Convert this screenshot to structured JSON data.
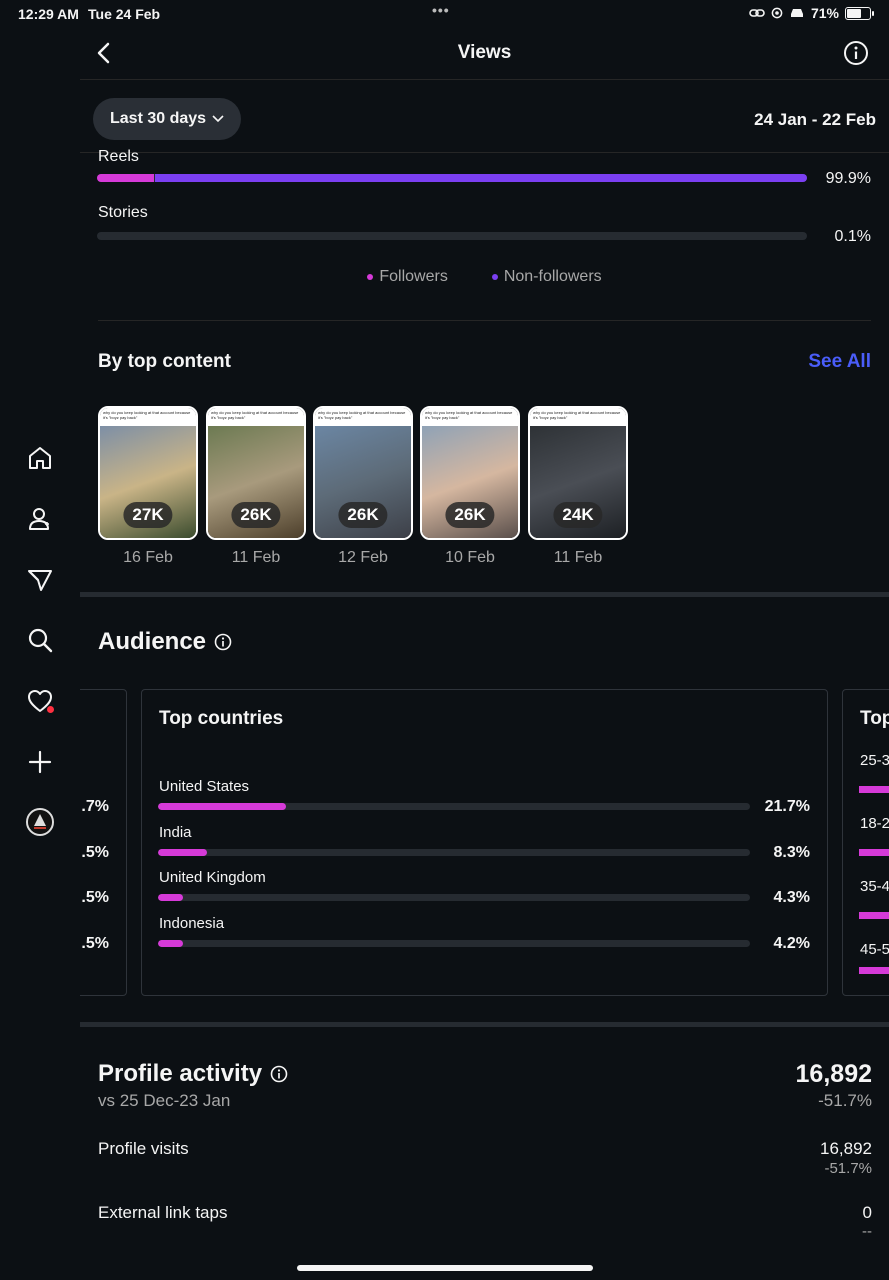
{
  "status_bar": {
    "time": "12:29 AM",
    "date": "Tue 24 Feb",
    "dots": "•••",
    "battery": "71%",
    "battery_level": 0.71
  },
  "header": {
    "title": "Views"
  },
  "range": {
    "button_label": "Last 30 days",
    "dates": "24 Jan - 22 Feb"
  },
  "content_types": [
    {
      "label": "Reels",
      "percent": "99.9%",
      "followers_share": 0.08,
      "nonfollowers_share": 0.92
    },
    {
      "label": "Stories",
      "percent": "0.1%",
      "followers_share": 0.0,
      "nonfollowers_share": 0.0
    }
  ],
  "legend": {
    "followers": "Followers",
    "non_followers": "Non-followers",
    "followers_color": "#d63ad8",
    "non_followers_color": "#7b3ff2"
  },
  "top_content": {
    "title": "By top content",
    "see_all": "See All",
    "caption": "why do you keep looking at that account because it's \"boyz pay back\"",
    "items": [
      {
        "views": "27K",
        "date": "16 Feb",
        "colors": [
          "#7d8fa6",
          "#c9b487",
          "#3b4c2e"
        ]
      },
      {
        "views": "26K",
        "date": "11 Feb",
        "colors": [
          "#6c7a52",
          "#a89a7d",
          "#4d3f2b"
        ]
      },
      {
        "views": "26K",
        "date": "12 Feb",
        "colors": [
          "#6b86a3",
          "#5d6b78",
          "#3d4048"
        ]
      },
      {
        "views": "26K",
        "date": "10 Feb",
        "colors": [
          "#8fa2b6",
          "#d5b7a0",
          "#5a4f4b"
        ]
      },
      {
        "views": "24K",
        "date": "11 Feb",
        "colors": [
          "#2e3236",
          "#4a4e55",
          "#1d2024"
        ]
      }
    ]
  },
  "audience": {
    "title": "Audience",
    "left_card_partial": [
      ".7%",
      ".5%",
      ".5%",
      ".5%"
    ],
    "top_countries": {
      "title": "Top countries",
      "items": [
        {
          "name": "United States",
          "percent": "21.7%",
          "fraction": 0.217
        },
        {
          "name": "India",
          "percent": "8.3%",
          "fraction": 0.083
        },
        {
          "name": "United Kingdom",
          "percent": "4.3%",
          "fraction": 0.043
        },
        {
          "name": "Indonesia",
          "percent": "4.2%",
          "fraction": 0.042
        }
      ]
    },
    "right_card_partial": {
      "title": "Top",
      "labels": [
        "25-3",
        "18-2",
        "35-4",
        "45-5"
      ]
    }
  },
  "profile_activity": {
    "title": "Profile activity",
    "comparison": "vs 25 Dec-23 Jan",
    "total": "16,892",
    "total_change": "-51.7%",
    "rows": [
      {
        "label": "Profile visits",
        "value": "16,892",
        "change": "-51.7%"
      },
      {
        "label": "External link taps",
        "value": "0",
        "change": "--"
      }
    ]
  },
  "nav": [
    "home-icon",
    "people-icon",
    "send-icon",
    "search-icon",
    "heart-icon",
    "plus-icon",
    "profile-avatar"
  ]
}
